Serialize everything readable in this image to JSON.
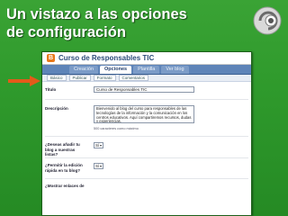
{
  "slide": {
    "title_line1": "Un vistazo a las opciones",
    "title_line2": "de configuración"
  },
  "colors": {
    "background": "#2f9a2c",
    "title_text": "#ffffff",
    "arrow": "#e35a1a",
    "tab_bar": "#5e84b8"
  },
  "screenshot": {
    "app_title": "Curso de Responsables TIC",
    "app_icon": "blogger-icon",
    "tabs": [
      {
        "label": "Creación",
        "active": false
      },
      {
        "label": "Opciones",
        "active": true
      },
      {
        "label": "Plantilla",
        "active": false
      },
      {
        "label": "Ver blog",
        "active": false
      }
    ],
    "subtabs": [
      "Básico",
      "Publicar",
      "Formato",
      "Comentarios"
    ],
    "form": {
      "title_label": "Título",
      "title_value": "Curso de Responsables TIC",
      "description_label": "Descripción",
      "description_value": "Bienvenido al blog del curso para responsables de las tecnologías de la información y la comunicación en los centros educativos. Aquí compartiremos recursos, dudas y experiencias.",
      "description_hint": "500 caracteres como máximo",
      "q1_label": "¿Deseas añadir tu blog a nuestras listas?",
      "q1_value": "Sí",
      "q2_label": "¿Permitir la edición rápida en tu blog?",
      "q2_value": "Sí",
      "q3_label": "¿Mostrar enlaces de"
    }
  }
}
